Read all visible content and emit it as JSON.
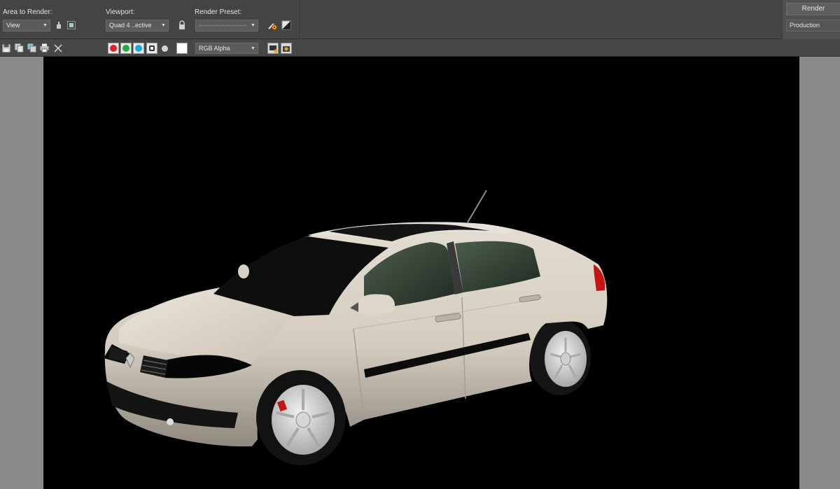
{
  "toolbar": {
    "area_to_render": {
      "label": "Area to Render:",
      "value": "View"
    },
    "viewport": {
      "label": "Viewport:",
      "value": "Quad 4 ..ective"
    },
    "render_preset": {
      "label": "Render Preset:",
      "value": ""
    },
    "render_button": "Render",
    "render_mode": "Production"
  },
  "frame_toolbar": {
    "channel_display": "RGB Alpha",
    "channel_colors": {
      "red": "#d8242a",
      "green": "#2aa844",
      "blue": "#1fa6d6"
    }
  },
  "render": {
    "background": "#000000",
    "subject": "white sedan car render"
  }
}
